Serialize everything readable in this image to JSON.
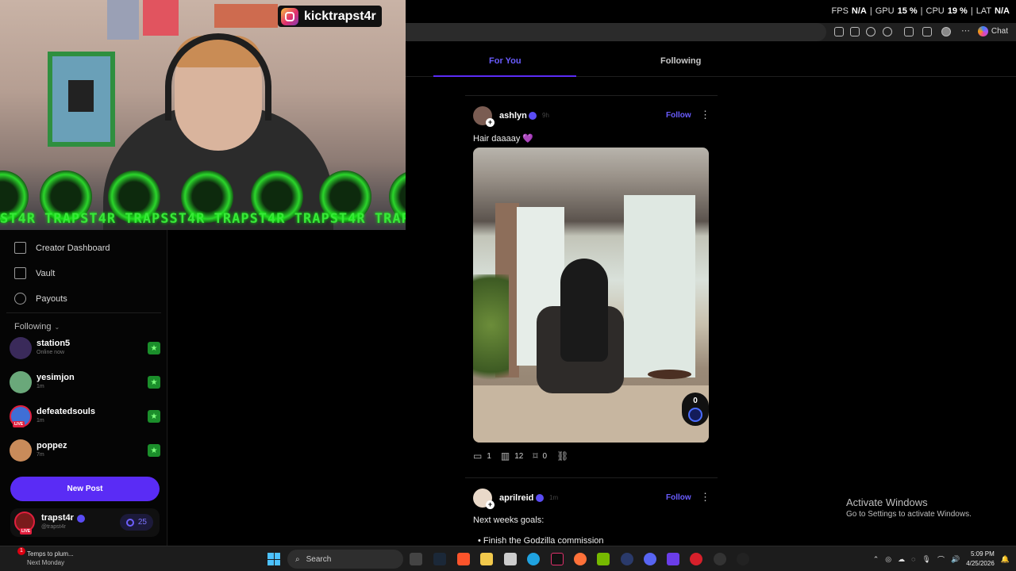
{
  "overlay": {
    "instagram_handle": "kicktrapst4r",
    "ticker_text": "ST4R  TRAPST4R  TRAPSST4R  TRAPST4R  TRAPST4R  TRAPST4R  TRA",
    "stats": {
      "fps_label": "FPS",
      "fps_value": "N/A",
      "gpu_label": "GPU",
      "gpu_value": "15 %",
      "cpu_label": "CPU",
      "cpu_value": "19 %",
      "lat_label": "LAT",
      "lat_value": "N/A"
    }
  },
  "browser": {
    "chat_label": "Chat"
  },
  "sidebar": {
    "nav": [
      {
        "label": "Creator Dashboard",
        "icon": "dashboard-icon"
      },
      {
        "label": "Vault",
        "icon": "vault-icon"
      },
      {
        "label": "Payouts",
        "icon": "dollar-icon"
      }
    ],
    "following_label": "Following",
    "following": [
      {
        "name": "station5",
        "status": "Online now",
        "avatar_color": "#3a2a5a",
        "live": false
      },
      {
        "name": "yesimjon",
        "status": "1m",
        "avatar_color": "#6aa87a",
        "live": false
      },
      {
        "name": "defeatedsouls",
        "status": "1m",
        "avatar_color": "#3f6fd6",
        "live": true,
        "live_label": "LIVE"
      },
      {
        "name": "poppez",
        "status": "7m",
        "avatar_color": "#c98b5a",
        "live": false
      }
    ],
    "new_post_label": "New Post",
    "me": {
      "name": "trapst4r",
      "handle": "@trapst4r",
      "live_label": "LIVE",
      "coins": "25"
    }
  },
  "feed": {
    "tabs": [
      {
        "label": "For You",
        "active": true
      },
      {
        "label": "Following",
        "active": false
      }
    ],
    "posts": [
      {
        "author": "ashlyn",
        "time": "9h",
        "follow_label": "Follow",
        "text": "Hair daaaay 💜",
        "votes": "0",
        "comments": "1",
        "views": "12",
        "saves": "0"
      },
      {
        "author": "aprilreid",
        "time": "1m",
        "follow_label": "Follow",
        "text": "Next weeks goals:",
        "bullet": "Finish the Godzilla commission"
      }
    ]
  },
  "windows_watermark": {
    "title": "Activate Windows",
    "subtitle": "Go to Settings to activate Windows."
  },
  "taskbar": {
    "weather_line1": "Temps to plum...",
    "weather_line2": "Next Monday",
    "notification_count": "1",
    "search_label": "Search",
    "time": "5:09 PM",
    "date": "4/25/2026"
  }
}
